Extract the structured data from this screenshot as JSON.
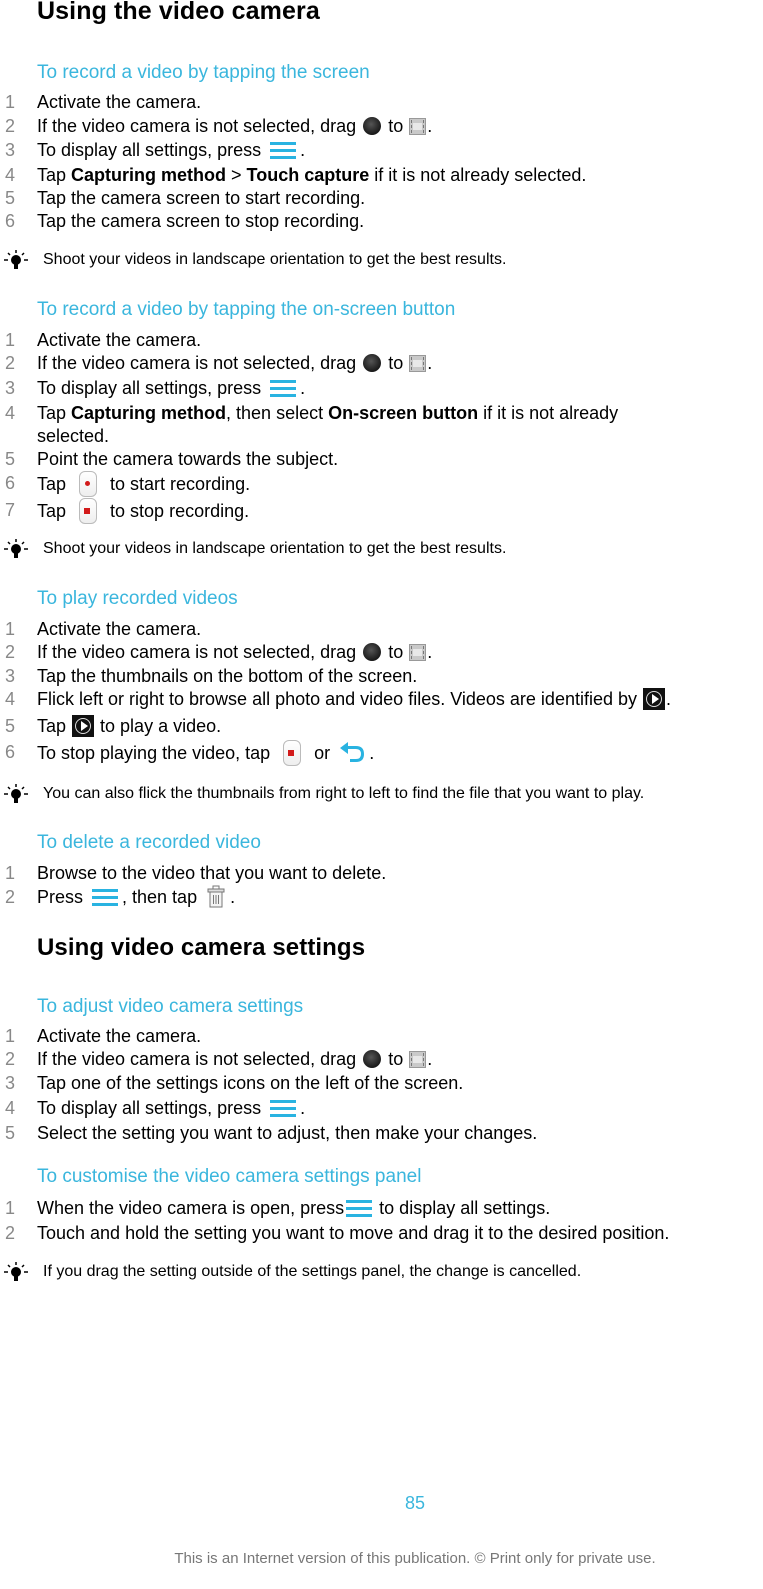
{
  "heading1": "Using the video camera",
  "sections": [
    {
      "title": "To record a video by tapping the screen",
      "steps": [
        {
          "num": "1",
          "parts": [
            "Activate the camera."
          ]
        },
        {
          "num": "2",
          "parts": [
            "If the video camera is not selected, drag ",
            " to ",
            "."
          ]
        },
        {
          "num": "3",
          "parts": [
            "To display all settings, press ",
            "."
          ]
        },
        {
          "num": "4",
          "parts": [
            "Tap ",
            "Capturing method",
            " > ",
            "Touch capture",
            " if it is not already selected."
          ]
        },
        {
          "num": "5",
          "parts": [
            "Tap the camera screen to start recording."
          ]
        },
        {
          "num": "6",
          "parts": [
            "Tap the camera screen to stop recording."
          ]
        }
      ],
      "tip": "Shoot your videos in landscape orientation to get the best results."
    },
    {
      "title": "To record a video by tapping the on-screen button",
      "steps": [
        {
          "num": "1",
          "parts": [
            "Activate the camera."
          ]
        },
        {
          "num": "2",
          "parts": [
            "If the video camera is not selected, drag ",
            " to ",
            "."
          ]
        },
        {
          "num": "3",
          "parts": [
            "To display all settings, press ",
            "."
          ]
        },
        {
          "num": "4",
          "parts": [
            "Tap ",
            "Capturing method",
            ", then select ",
            "On-screen button",
            " if it is not already",
            "selected."
          ]
        },
        {
          "num": "5",
          "parts": [
            "Point the camera towards the subject."
          ]
        },
        {
          "num": "6",
          "parts": [
            "Tap ",
            " to start recording."
          ]
        },
        {
          "num": "7",
          "parts": [
            "Tap ",
            " to stop recording."
          ]
        }
      ],
      "tip": "Shoot your videos in landscape orientation to get the best results."
    },
    {
      "title": "To play recorded videos",
      "steps": [
        {
          "num": "1",
          "parts": [
            "Activate the camera."
          ]
        },
        {
          "num": "2",
          "parts": [
            "If the video camera is not selected, drag ",
            " to ",
            "."
          ]
        },
        {
          "num": "3",
          "parts": [
            "Tap the thumbnails on the bottom of the screen."
          ]
        },
        {
          "num": "4",
          "parts": [
            "Flick left or right to browse all photo and video files. Videos are identified by ",
            "."
          ]
        },
        {
          "num": "5",
          "parts": [
            "Tap ",
            " to play a video."
          ]
        },
        {
          "num": "6",
          "parts": [
            "To stop playing the video, tap ",
            " or ",
            "."
          ]
        }
      ],
      "tip": "You can also flick the thumbnails from right to left to find the file that you want to play."
    },
    {
      "title": "To delete a recorded video",
      "steps": [
        {
          "num": "1",
          "parts": [
            "Browse to the video that you want to delete."
          ]
        },
        {
          "num": "2",
          "parts": [
            "Press ",
            ", then tap ",
            "."
          ]
        }
      ]
    }
  ],
  "heading2": "Using video camera settings",
  "sections2": [
    {
      "title": "To adjust video camera settings",
      "steps": [
        {
          "num": "1",
          "parts": [
            "Activate the camera."
          ]
        },
        {
          "num": "2",
          "parts": [
            "If the video camera is not selected, drag ",
            " to ",
            "."
          ]
        },
        {
          "num": "3",
          "parts": [
            "Tap one of the settings icons on the left of the screen."
          ]
        },
        {
          "num": "4",
          "parts": [
            "To display all settings, press ",
            "."
          ]
        },
        {
          "num": "5",
          "parts": [
            "Select the setting you want to adjust, then make your changes."
          ]
        }
      ]
    },
    {
      "title": "To customise the video camera settings panel",
      "steps": [
        {
          "num": "1",
          "parts": [
            "When the video camera is open, press",
            " to display all settings."
          ]
        },
        {
          "num": "2",
          "parts": [
            "Touch and hold the setting you want to move and drag it to the desired position."
          ]
        }
      ],
      "tip": "If you drag the setting outside of the settings panel, the change is cancelled."
    }
  ],
  "footer": {
    "page_number": "85",
    "note": "This is an Internet version of this publication. © Print only for private use."
  },
  "colors": {
    "accent": "#3ab6dd",
    "menu_icon": "#29b3e1",
    "record_dot": "#d21a1a"
  }
}
